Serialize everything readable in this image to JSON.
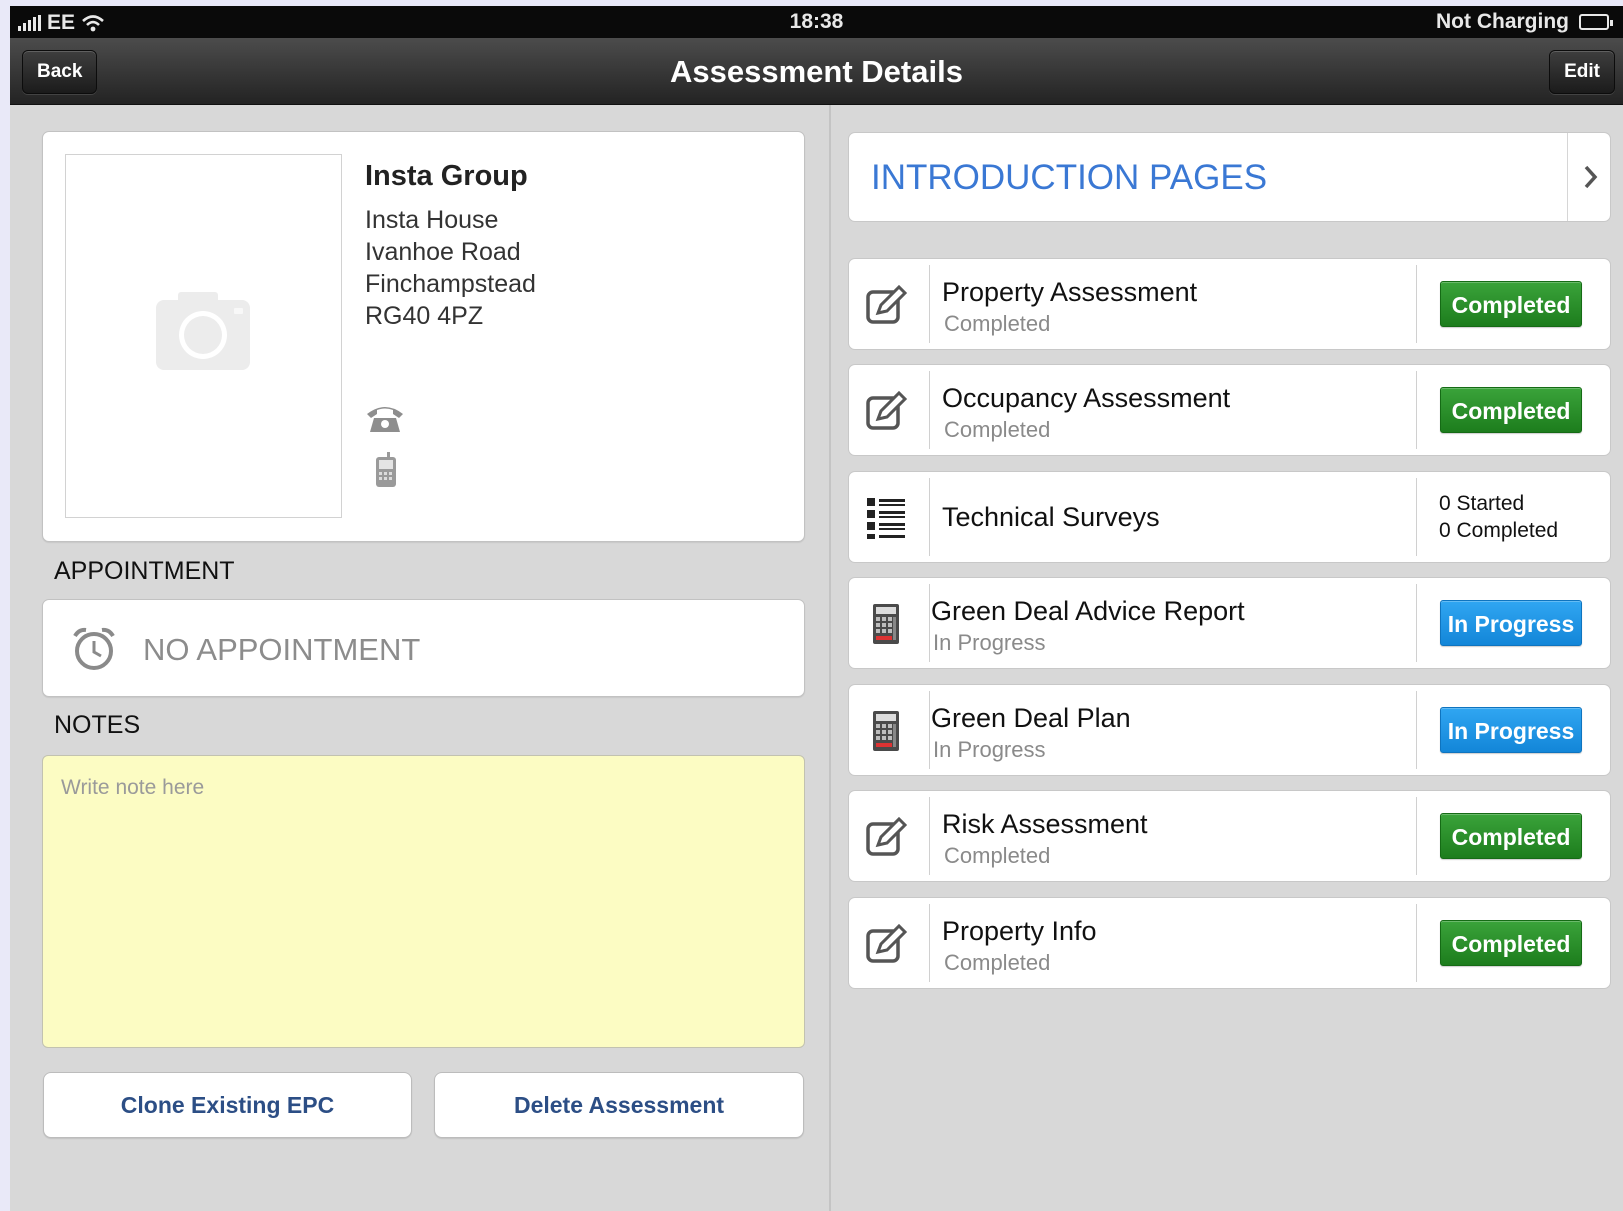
{
  "status_bar": {
    "carrier": "EE",
    "time": "18:38",
    "battery_status": "Not Charging",
    "icons": [
      "signal-icon",
      "wifi-icon",
      "battery-icon"
    ]
  },
  "nav": {
    "title": "Assessment Details",
    "back_label": "Back",
    "edit_label": "Edit"
  },
  "contact": {
    "name": "Insta Group",
    "address": [
      "Insta House",
      "Ivanhoe Road",
      "Finchampstead",
      "RG40 4PZ"
    ],
    "icons": [
      "camera-icon",
      "phone-icon",
      "mobile-icon"
    ]
  },
  "appointment": {
    "section_label": "APPOINTMENT",
    "text": "NO APPOINTMENT",
    "icon": "alarm-clock-icon"
  },
  "notes": {
    "section_label": "NOTES",
    "placeholder": "Write note here",
    "value": ""
  },
  "actions": {
    "clone_label": "Clone Existing EPC",
    "delete_label": "Delete Assessment"
  },
  "intro": {
    "label": "INTRODUCTION PAGES",
    "icon": "chevron-right-icon"
  },
  "assessments": [
    {
      "title": "Property Assessment",
      "subtitle": "Completed",
      "icon": "edit-icon",
      "badge": "Completed"
    },
    {
      "title": "Occupancy Assessment",
      "subtitle": "Completed",
      "icon": "edit-icon",
      "badge": "Completed"
    },
    {
      "title": "Technical Surveys",
      "icon": "list-icon",
      "started": "0 Started",
      "completed": "0 Completed"
    },
    {
      "title": "Green Deal Advice Report",
      "subtitle": "In Progress",
      "icon": "calculator-icon",
      "badge": "In Progress"
    },
    {
      "title": "Green Deal Plan",
      "subtitle": "In Progress",
      "icon": "calculator-icon",
      "badge": "In Progress"
    },
    {
      "title": "Risk Assessment",
      "subtitle": "Completed",
      "icon": "edit-icon",
      "badge": "Completed"
    },
    {
      "title": "Property Info",
      "subtitle": "Completed",
      "icon": "edit-icon",
      "badge": "Completed"
    }
  ],
  "colors": {
    "completed_green": "#2a912a",
    "in_progress_blue": "#1e95e6",
    "intro_blue": "#3a78d4",
    "notes_yellow": "#fcfcc3",
    "button_text_blue": "#2c4e85"
  }
}
